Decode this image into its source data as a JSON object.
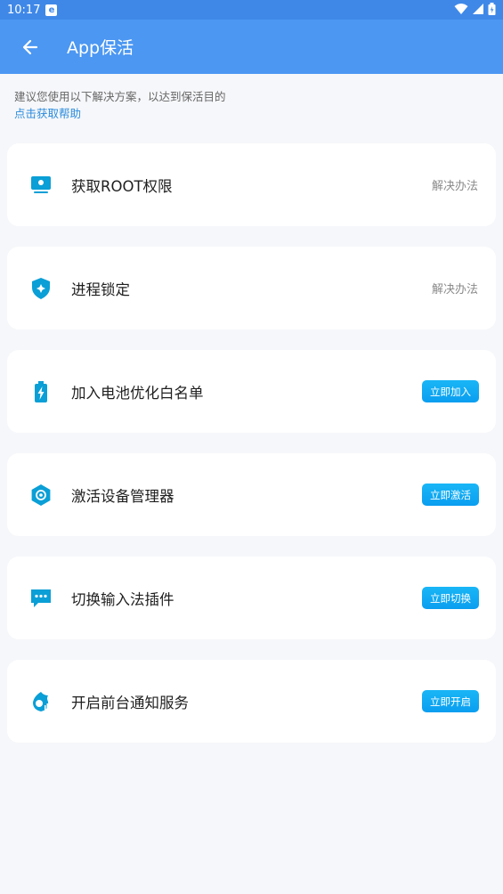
{
  "status": {
    "time": "10:17",
    "notif_glyph": "e"
  },
  "appbar": {
    "title": "App保活"
  },
  "hint": {
    "text": "建议您使用以下解决方案，以达到保活目的",
    "help_link": "点击获取帮助"
  },
  "items": [
    {
      "icon": "monitor-icon",
      "label": "获取ROOT权限",
      "action": "解决办法",
      "action_style": "text"
    },
    {
      "icon": "shield-icon",
      "label": "进程锁定",
      "action": "解决办法",
      "action_style": "text"
    },
    {
      "icon": "battery-icon",
      "label": "加入电池优化白名单",
      "action": "立即加入",
      "action_style": "button"
    },
    {
      "icon": "gear-hexagon-icon",
      "label": "激活设备管理器",
      "action": "立即激活",
      "action_style": "button"
    },
    {
      "icon": "chat-bubble-icon",
      "label": "切换输入法插件",
      "action": "立即切换",
      "action_style": "button"
    },
    {
      "icon": "notification-service-icon",
      "label": "开启前台通知服务",
      "action": "立即开启",
      "action_style": "button"
    }
  ],
  "colors": {
    "appbar": "#4b97f2",
    "statusbar": "#3f88e8",
    "accent": "#0aa3f0",
    "link": "#2a8bdc",
    "icon": "#0a9fd6"
  }
}
